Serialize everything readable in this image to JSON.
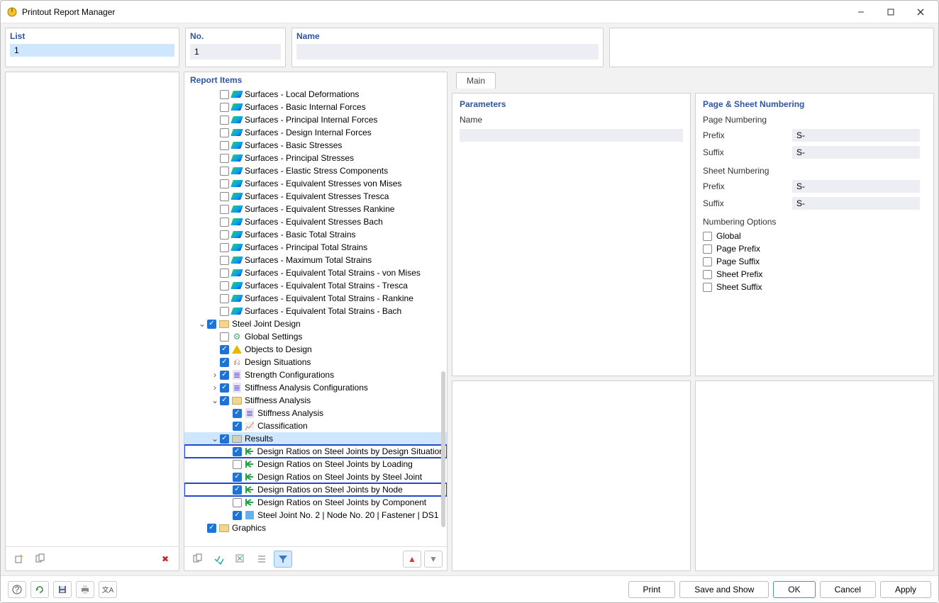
{
  "window": {
    "title": "Printout Report Manager"
  },
  "top": {
    "list_label": "List",
    "no_label": "No.",
    "name_label": "Name",
    "no_value": "1",
    "name_value": "",
    "list_item": "1"
  },
  "tree": {
    "header": "Report Items",
    "surfaces": [
      "Surfaces - Local Deformations",
      "Surfaces - Basic Internal Forces",
      "Surfaces - Principal Internal Forces",
      "Surfaces - Design Internal Forces",
      "Surfaces - Basic Stresses",
      "Surfaces - Principal Stresses",
      "Surfaces - Elastic Stress Components",
      "Surfaces - Equivalent Stresses von Mises",
      "Surfaces - Equivalent Stresses Tresca",
      "Surfaces - Equivalent Stresses Rankine",
      "Surfaces - Equivalent Stresses Bach",
      "Surfaces - Basic Total Strains",
      "Surfaces - Principal Total Strains",
      "Surfaces - Maximum Total Strains",
      "Surfaces - Equivalent Total Strains - von Mises",
      "Surfaces - Equivalent Total Strains - Tresca",
      "Surfaces - Equivalent Total Strains - Rankine",
      "Surfaces - Equivalent Total Strains - Bach"
    ],
    "steel": {
      "label": "Steel Joint Design",
      "global": "Global Settings",
      "objects": "Objects to Design",
      "situations": "Design Situations",
      "strength": "Strength Configurations",
      "stiff_cfg": "Stiffness Analysis Configurations",
      "stiff_grp": "Stiffness Analysis",
      "stiff_ana": "Stiffness Analysis",
      "classif": "Classification",
      "results": {
        "label": "Results",
        "r1": "Design Ratios on Steel Joints by Design Situation",
        "r2": "Design Ratios on Steel Joints by Loading",
        "r3": "Design Ratios on Steel Joints by Steel Joint",
        "r4": "Design Ratios on Steel Joints by Node",
        "r5": "Design Ratios on Steel Joints by Component",
        "r6": "Steel Joint No. 2 | Node No. 20 | Fastener | DS1"
      }
    },
    "graphics": "Graphics"
  },
  "tabs": {
    "main": "Main"
  },
  "params": {
    "header": "Parameters",
    "name": "Name",
    "name_value": ""
  },
  "numbering": {
    "header": "Page & Sheet Numbering",
    "page_num": "Page Numbering",
    "sheet_num": "Sheet Numbering",
    "prefix": "Prefix",
    "suffix": "Suffix",
    "page_prefix_v": "S-",
    "page_suffix_v": "S-",
    "sheet_prefix_v": "S-",
    "sheet_suffix_v": "S-",
    "opts": "Numbering Options",
    "global": "Global",
    "pp": "Page Prefix",
    "ps": "Page Suffix",
    "sp": "Sheet Prefix",
    "ss": "Sheet Suffix"
  },
  "footer": {
    "print": "Print",
    "save_show": "Save and Show",
    "ok": "OK",
    "cancel": "Cancel",
    "apply": "Apply"
  }
}
